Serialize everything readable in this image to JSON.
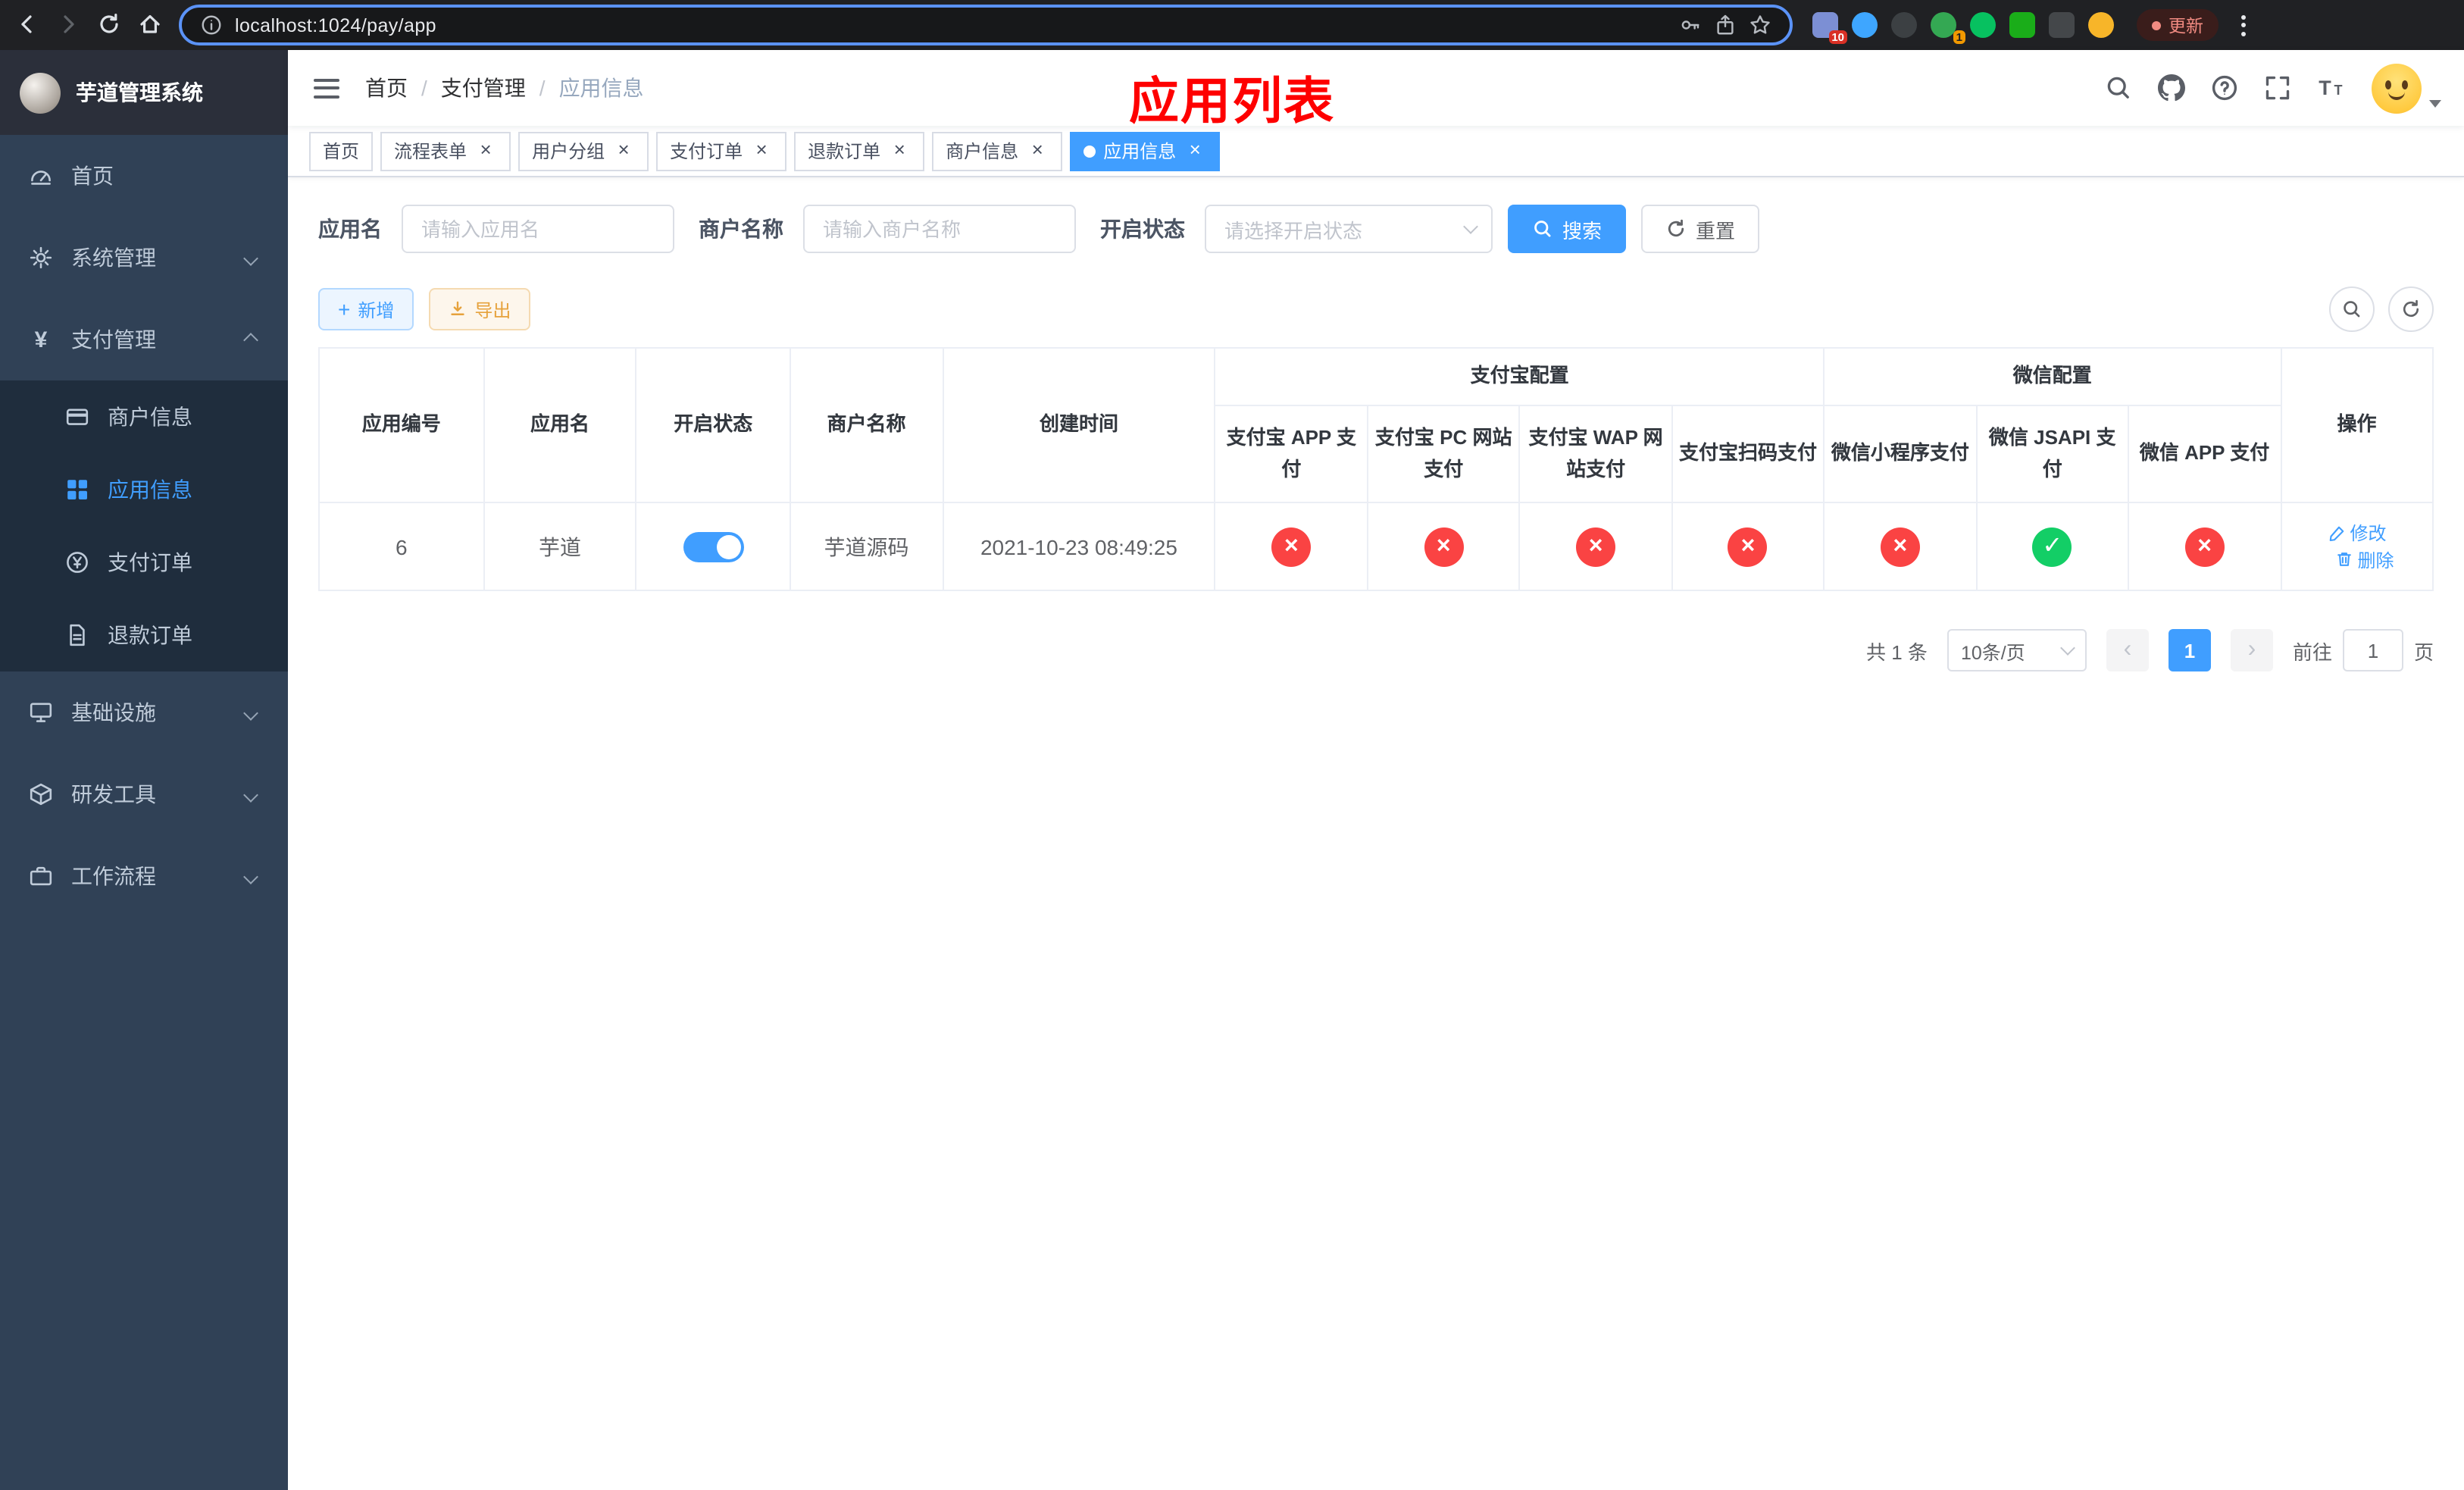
{
  "browser": {
    "url": "localhost:1024/pay/app",
    "update_label": "更新",
    "ext_badge_blue": "10",
    "ext_badge_green": "1"
  },
  "sidebar": {
    "logo_title": "芋道管理系统",
    "menu": [
      {
        "label": "首页"
      },
      {
        "label": "系统管理"
      },
      {
        "label": "支付管理"
      },
      {
        "label": "商户信息"
      },
      {
        "label": "应用信息"
      },
      {
        "label": "支付订单"
      },
      {
        "label": "退款订单"
      },
      {
        "label": "基础设施"
      },
      {
        "label": "研发工具"
      },
      {
        "label": "工作流程"
      }
    ]
  },
  "header": {
    "breadcrumb": [
      "首页",
      "支付管理",
      "应用信息"
    ],
    "annotation": "应用列表"
  },
  "tabs": [
    {
      "label": "首页",
      "closable": false,
      "active": false
    },
    {
      "label": "流程表单",
      "closable": true,
      "active": false
    },
    {
      "label": "用户分组",
      "closable": true,
      "active": false
    },
    {
      "label": "支付订单",
      "closable": true,
      "active": false
    },
    {
      "label": "退款订单",
      "closable": true,
      "active": false
    },
    {
      "label": "商户信息",
      "closable": true,
      "active": false
    },
    {
      "label": "应用信息",
      "closable": true,
      "active": true
    }
  ],
  "filters": {
    "app_name_label": "应用名",
    "app_name_placeholder": "请输入应用名",
    "merchant_label": "商户名称",
    "merchant_placeholder": "请输入商户名称",
    "status_label": "开启状态",
    "status_placeholder": "请选择开启状态",
    "search_label": "搜索",
    "reset_label": "重置"
  },
  "toolbar": {
    "add_label": "新增",
    "export_label": "导出"
  },
  "table": {
    "headers": {
      "app_id": "应用编号",
      "app_name": "应用名",
      "status": "开启状态",
      "merchant": "商户名称",
      "created": "创建时间",
      "alipay_group": "支付宝配置",
      "wechat_group": "微信配置",
      "actions": "操作",
      "sub": [
        "支付宝 APP 支付",
        "支付宝 PC 网站支付",
        "支付宝 WAP 网站支付",
        "支付宝扫码支付",
        "微信小程序支付",
        "微信 JSAPI 支付",
        "微信 APP 支付"
      ]
    },
    "row": {
      "app_id": "6",
      "app_name": "芋道",
      "enabled": true,
      "merchant": "芋道源码",
      "created": "2021-10-23 08:49:25",
      "statuses": [
        "fail",
        "fail",
        "fail",
        "fail",
        "fail",
        "pass",
        "fail"
      ],
      "edit_label": "修改",
      "delete_label": "删除"
    }
  },
  "pagination": {
    "total_label": "共 1 条",
    "page_size": "10条/页",
    "current_page": "1",
    "goto_label": "前往",
    "goto_value": "1",
    "page_label": "页"
  },
  "icons": {
    "search": "magnifier",
    "reset": "refresh",
    "add": "plus",
    "export": "download",
    "edit": "pencil",
    "delete": "trash",
    "github": "octocat",
    "help": "question-circle",
    "fullscreen": "expand",
    "font_size": "text-size",
    "close_tab": "x",
    "fail": "×",
    "pass": "✓"
  },
  "colors": {
    "accent": "#409eff",
    "success": "#13ce66",
    "danger": "#fa4343",
    "sidebar_bg": "#304156",
    "submenu_bg": "#1f2d3d",
    "annotation": "#fe0000"
  }
}
